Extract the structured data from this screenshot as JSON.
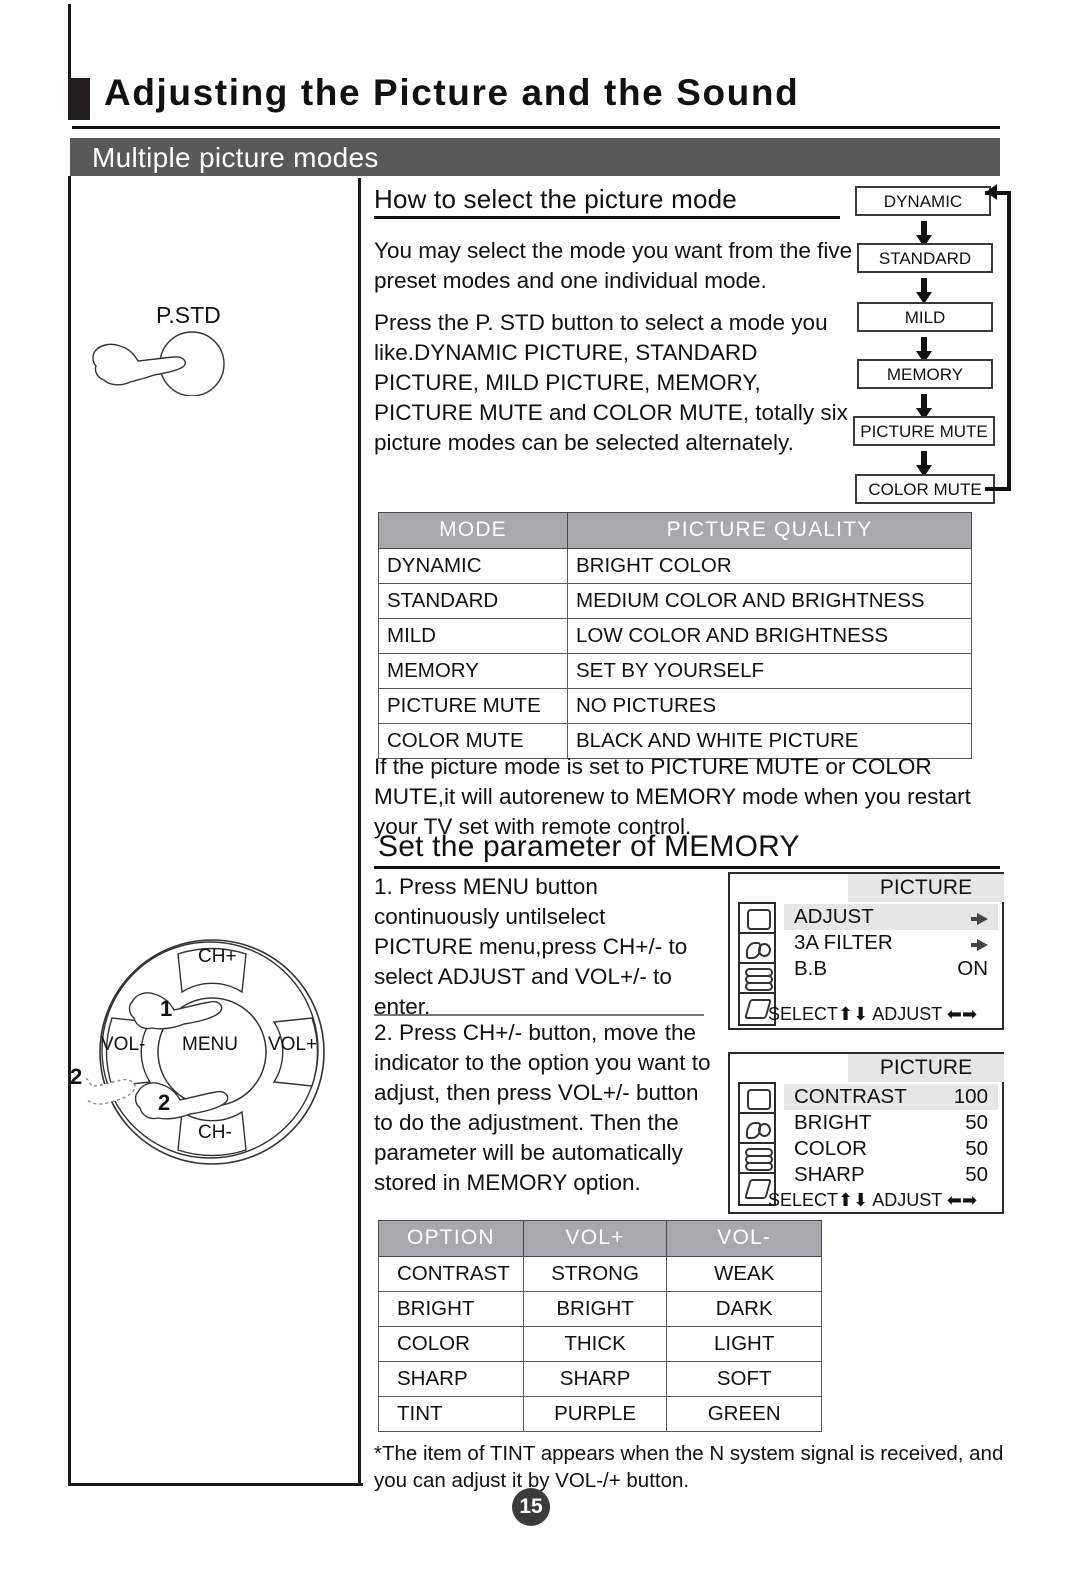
{
  "document": {
    "title": "Adjusting the Picture and the Sound",
    "section_bar": "Multiple picture modes",
    "page_number": "15"
  },
  "left_column": {
    "pstd_label": "P.STD",
    "remote": {
      "ch_up": "CH+",
      "ch_down": "CH-",
      "vol_down": "VOL-",
      "vol_up": "VOL+",
      "menu": "MENU",
      "step_1": "1",
      "step_2": "2",
      "step_2_outer": "2"
    }
  },
  "how_to_select": {
    "heading": "How to select the picture mode",
    "paragraph_1": "You may select the mode you want  from the five preset modes and one individual mode.",
    "paragraph_2": "Press the P. STD button to select a mode you like.DYNAMIC PICTURE, STANDARD PICTURE, MILD PICTURE, MEMORY, PICTURE MUTE and COLOR MUTE, totally six picture modes  can be selected alternately.",
    "note": "If the picture mode is set to PICTURE MUTE or COLOR MUTE,it will autorenew to MEMORY mode when you restart your TV set with remote control."
  },
  "mode_flow": {
    "steps": [
      "DYNAMIC",
      "STANDARD",
      "MILD",
      "MEMORY",
      "PICTURE MUTE",
      "COLOR MUTE"
    ]
  },
  "mode_table": {
    "headers": [
      "MODE",
      "PICTURE QUALITY"
    ],
    "rows": [
      [
        "DYNAMIC",
        "BRIGHT COLOR"
      ],
      [
        "STANDARD",
        "MEDIUM COLOR AND BRIGHTNESS"
      ],
      [
        "MILD",
        "LOW COLOR AND BRIGHTNESS"
      ],
      [
        "MEMORY",
        "SET BY YOURSELF"
      ],
      [
        "PICTURE MUTE",
        "NO PICTURES"
      ],
      [
        "COLOR MUTE",
        "BLACK AND WHITE PICTURE"
      ]
    ]
  },
  "set_parameter": {
    "heading": "Set the parameter of MEMORY",
    "step_1": "1. Press MENU button continuously untilselect PICTURE menu,press CH+/- to select ADJUST and VOL+/- to enter.",
    "step_2": "2. Press CH+/- button, move the indicator  to the option you want to adjust, then press VOL+/- button to do the adjustment. Then the parameter  will be automatically stored in MEMORY option."
  },
  "osd_panel_1": {
    "title": "PICTURE",
    "rows": [
      {
        "label": "ADJUST",
        "value": "arrow",
        "selected": true
      },
      {
        "label": "3A FILTER",
        "value": "arrow",
        "selected": false
      },
      {
        "label": "B.B",
        "value": "ON",
        "selected": false
      }
    ],
    "footer_select": "SELECT",
    "footer_adjust": "ADJUST",
    "icons": [
      "tv-screen-icon",
      "sound-icon",
      "tuner-stack-icon",
      "function-diamond-icon"
    ]
  },
  "osd_panel_2": {
    "title": "PICTURE",
    "rows": [
      {
        "label": "CONTRAST",
        "value": "100",
        "selected": true
      },
      {
        "label": "BRIGHT",
        "value": "50",
        "selected": false
      },
      {
        "label": "COLOR",
        "value": "50",
        "selected": false
      },
      {
        "label": "SHARP",
        "value": "50",
        "selected": false
      }
    ],
    "footer_select": "SELECT",
    "footer_adjust": "ADJUST",
    "icons": [
      "tv-screen-icon",
      "sound-icon",
      "tuner-stack-icon",
      "function-diamond-icon"
    ]
  },
  "option_table": {
    "headers": [
      "OPTION",
      "VOL+",
      "VOL-"
    ],
    "rows": [
      [
        "CONTRAST",
        "STRONG",
        "WEAK"
      ],
      [
        "BRIGHT",
        "BRIGHT",
        "DARK"
      ],
      [
        "COLOR",
        "THICK",
        "LIGHT"
      ],
      [
        "SHARP",
        "SHARP",
        "SOFT"
      ],
      [
        "TINT",
        "PURPLE",
        "GREEN"
      ]
    ]
  },
  "footnote": "*The item of TINT appears when the N system signal is received, and you can adjust it by  VOL-/+ button.",
  "colors": {
    "section_bar": "#595959",
    "table_header": "#a9a9ad",
    "osd_highlight": "#e6e6e6",
    "page_number_bg": "#3b3b3b"
  }
}
